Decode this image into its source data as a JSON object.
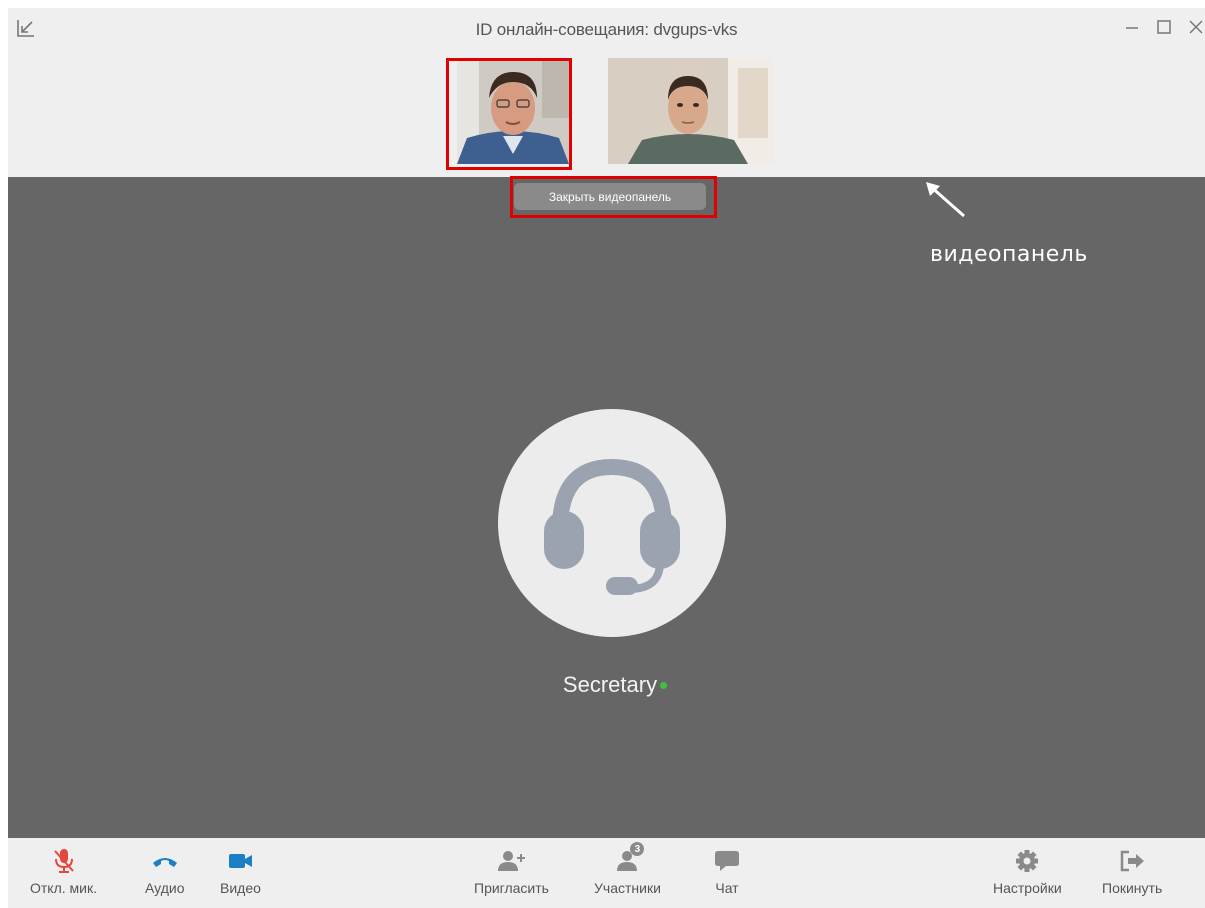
{
  "window": {
    "title": "ID онлайн-совещания: dvgups-vks"
  },
  "videopanel": {
    "close_label": "Закрыть видеопанель",
    "annotation": "видеопанель"
  },
  "stage": {
    "participant_name": "Secretary"
  },
  "toolbar": {
    "mute": "Откл. мик.",
    "audio": "Аудио",
    "video": "Видео",
    "invite": "Пригласить",
    "participants": "Участники",
    "participants_count": "3",
    "chat": "Чат",
    "settings": "Настройки",
    "leave": "Покинуть"
  },
  "colors": {
    "highlight": "#e00000",
    "mute_active": "#e5473f",
    "audio_blue": "#1c7fc4",
    "status_online": "#3ec23e",
    "stage_bg": "#666666"
  }
}
